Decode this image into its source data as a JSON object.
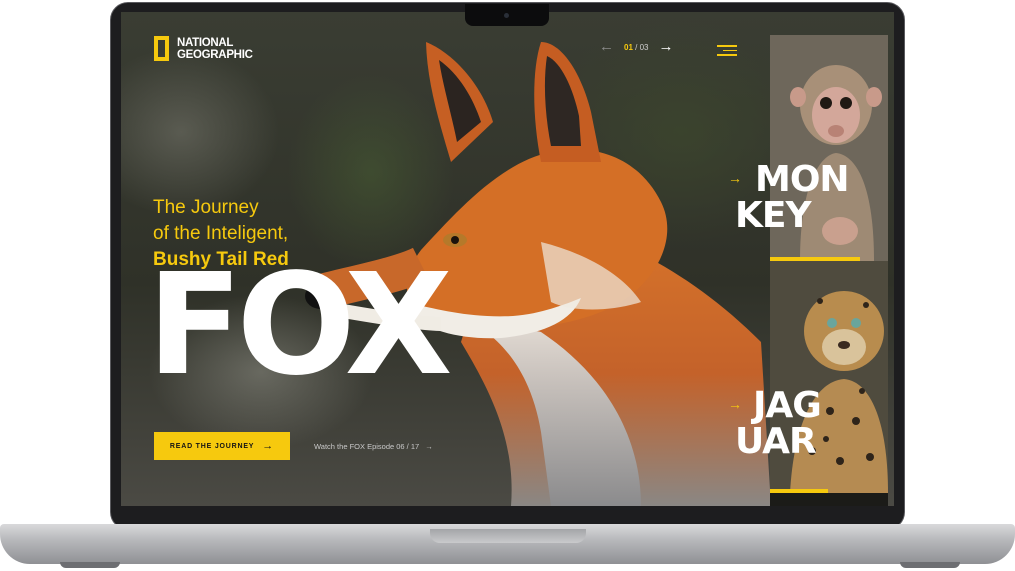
{
  "brand": {
    "name_line1": "NATIONAL",
    "name_line2": "GEOGRAPHIC",
    "accent": "#f6c90e"
  },
  "pager": {
    "current": "01",
    "separator": "/",
    "total": "03",
    "prev_icon": "arrow-left-icon",
    "next_icon": "arrow-right-icon"
  },
  "menu": {
    "icon": "hamburger-menu-icon"
  },
  "hero": {
    "line1": "The Journey",
    "line2": "of the Inteligent,",
    "line3": "Bushy Tail Red",
    "title": "FOX"
  },
  "cta": {
    "label": "READ THE JOURNEY",
    "icon": "arrow-right-icon"
  },
  "watch": {
    "label": "Watch the FOX Episode 06 / 17",
    "icon": "arrow-right-icon"
  },
  "side": [
    {
      "line1": "MON",
      "line2": "KEY",
      "image": "monkey-photo"
    },
    {
      "line1": "JAG",
      "line2": "UAR",
      "image": "jaguar-photo"
    }
  ]
}
